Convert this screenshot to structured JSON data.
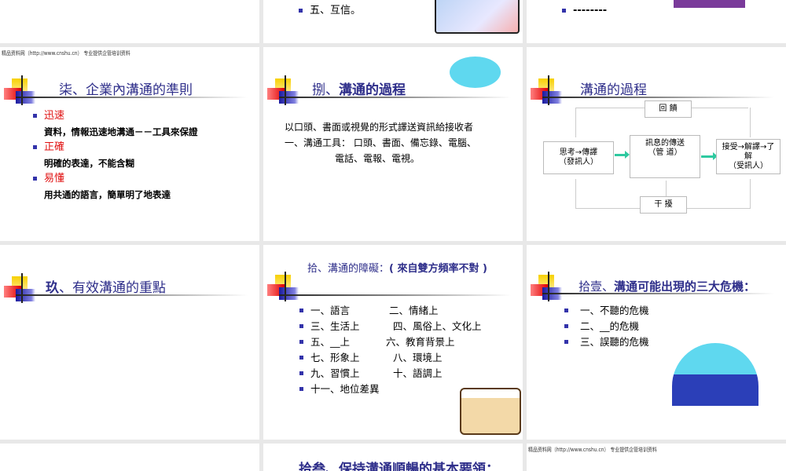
{
  "watermark": "精品资料网（http://www.cnshu.cn） 专业提供企管培训资料",
  "slides": {
    "top_middle": {
      "bullet": "五、互信。"
    },
    "top_right": {
      "bullet": "--------"
    },
    "s7": {
      "title": "柒、企業內溝通的準則",
      "items": [
        {
          "head": "迅速",
          "text": "資料，情報迅速地溝通－－工具來保證"
        },
        {
          "head": "正確",
          "text": "明確的表達，不能含糊"
        },
        {
          "head": "易懂",
          "text": "用共通的語言，簡單明了地表達"
        }
      ]
    },
    "s8": {
      "title_prefix": "捌、",
      "title_main": "溝通的過程",
      "line1": "以口頭、書面或視覺的形式譯送資訊給接收者",
      "line2": "一、溝通工具：  口頭、書面、備忘錄、電腦、",
      "line3": "電話、電報、電視。"
    },
    "process": {
      "title": "溝通的過程",
      "feedback": "回  饋",
      "sender_1": "思考→傳譯",
      "sender_2": "（發訊人）",
      "channel_1": "訊息的傳送",
      "channel_2": "（管  道）",
      "receiver_1": "接受→解譯→了",
      "receiver_2": "解",
      "receiver_3": "（受訊人）",
      "noise": "干 擾"
    },
    "s9": {
      "title_prefix": "玖",
      "title_main": "、有效溝通的重點"
    },
    "s10": {
      "title": "拾、溝通的障礙：",
      "title_note": "( 來自雙方頻率不對 )",
      "rows": [
        [
          "一、語言",
          "二、情緒上"
        ],
        [
          "三、生活上",
          "四、風俗上、文化上"
        ],
        [
          "五、__上",
          "六、教育背景上"
        ],
        [
          "七、形象上",
          "八、環境上"
        ],
        [
          "九、習慣上",
          "十、語調上"
        ],
        [
          "十一、地位差異",
          ""
        ]
      ]
    },
    "s11": {
      "title_prefix": "拾壹、",
      "title_main": "溝通可能出現的三大危機：",
      "items": [
        "一、不聽的危機",
        "二、__的危機",
        "三、誤聽的危機"
      ]
    },
    "s13": {
      "title": "拾叁、保持溝通順暢的基本要領："
    }
  }
}
